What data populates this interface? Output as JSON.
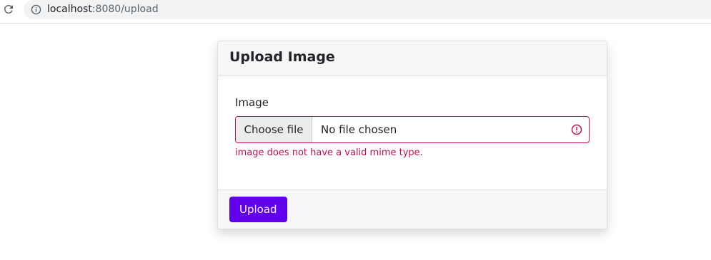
{
  "browser": {
    "url_host": "localhost",
    "url_rest": ":8080/upload",
    "reload_icon": "reload-icon",
    "info_icon": "info-icon"
  },
  "form": {
    "title": "Upload Image",
    "field_label": "Image",
    "choose_label": "Choose file",
    "file_status": "No file chosen",
    "error_icon": "error-circle-icon",
    "error_message": "image does not have a valid mime type.",
    "submit_label": "Upload"
  },
  "colors": {
    "primary": "#6200ee",
    "invalid": "#c4104a",
    "card_header_bg": "#f7f7f7"
  }
}
